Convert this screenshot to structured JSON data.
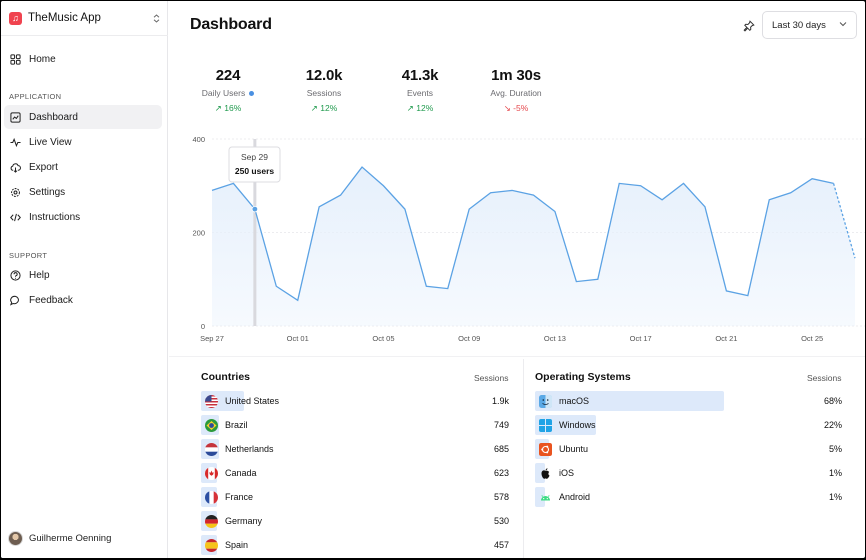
{
  "app": {
    "name": "TheMusic App"
  },
  "sidebar": {
    "home": "Home",
    "section_app": "APPLICATION",
    "items": [
      {
        "label": "Dashboard",
        "icon": "chart-icon"
      },
      {
        "label": "Live View",
        "icon": "activity-icon"
      },
      {
        "label": "Export",
        "icon": "cloud-download-icon"
      },
      {
        "label": "Settings",
        "icon": "gear-icon"
      },
      {
        "label": "Instructions",
        "icon": "code-icon"
      }
    ],
    "section_support": "SUPPORT",
    "support_items": [
      {
        "label": "Help",
        "icon": "help-icon"
      },
      {
        "label": "Feedback",
        "icon": "message-icon"
      }
    ],
    "user": "Guilherme Oenning"
  },
  "header": {
    "title": "Dashboard",
    "range": "Last 30 days"
  },
  "kpis": [
    {
      "value": "224",
      "label": "Daily Users",
      "delta": "16%",
      "trend": "up"
    },
    {
      "value": "12.0k",
      "label": "Sessions",
      "delta": "12%",
      "trend": "up"
    },
    {
      "value": "41.3k",
      "label": "Events",
      "delta": "12%",
      "trend": "up"
    },
    {
      "value": "1m 30s",
      "label": "Avg. Duration",
      "delta": "-5%",
      "trend": "down"
    }
  ],
  "chart_data": {
    "type": "area",
    "x_ticks": [
      "Sep 27",
      "Oct 01",
      "Oct 05",
      "Oct 09",
      "Oct 13",
      "Oct 17",
      "Oct 21",
      "Oct 25"
    ],
    "y_ticks": [
      "0",
      "200",
      "400"
    ],
    "ylim": [
      0,
      400
    ],
    "values": [
      290,
      305,
      250,
      85,
      55,
      255,
      280,
      340,
      300,
      250,
      85,
      80,
      250,
      285,
      290,
      280,
      245,
      95,
      100,
      305,
      300,
      270,
      305,
      255,
      75,
      65,
      270,
      285,
      315,
      305,
      145
    ],
    "tooltip": {
      "date": "Sep 29",
      "text": "250 users"
    },
    "colors": {
      "line": "#5ba2e4",
      "fill": "#e6f0fc"
    }
  },
  "countries": {
    "title": "Countries",
    "column": "Sessions",
    "rows": [
      {
        "label": "United States",
        "value": "1.9k",
        "icon": "us-flag-icon",
        "share": 0.22
      },
      {
        "label": "Brazil",
        "value": "749",
        "icon": "br-flag-icon",
        "share": 0.09
      },
      {
        "label": "Netherlands",
        "value": "685",
        "icon": "nl-flag-icon",
        "share": 0.09
      },
      {
        "label": "Canada",
        "value": "623",
        "icon": "ca-flag-icon",
        "share": 0.08
      },
      {
        "label": "France",
        "value": "578",
        "icon": "fr-flag-icon",
        "share": 0.08
      },
      {
        "label": "Germany",
        "value": "530",
        "icon": "de-flag-icon",
        "share": 0.07
      },
      {
        "label": "Spain",
        "value": "457",
        "icon": "es-flag-icon",
        "share": 0.07
      }
    ]
  },
  "os": {
    "title": "Operating Systems",
    "column": "Sessions",
    "rows": [
      {
        "label": "macOS",
        "value": "68%",
        "icon": "macos-icon",
        "share": 0.68
      },
      {
        "label": "Windows",
        "value": "22%",
        "icon": "windows-icon",
        "share": 0.22
      },
      {
        "label": "Ubuntu",
        "value": "5%",
        "icon": "ubuntu-icon",
        "share": 0.05
      },
      {
        "label": "iOS",
        "value": "1%",
        "icon": "apple-icon",
        "share": 0.01
      },
      {
        "label": "Android",
        "value": "1%",
        "icon": "android-icon",
        "share": 0.01
      }
    ]
  }
}
